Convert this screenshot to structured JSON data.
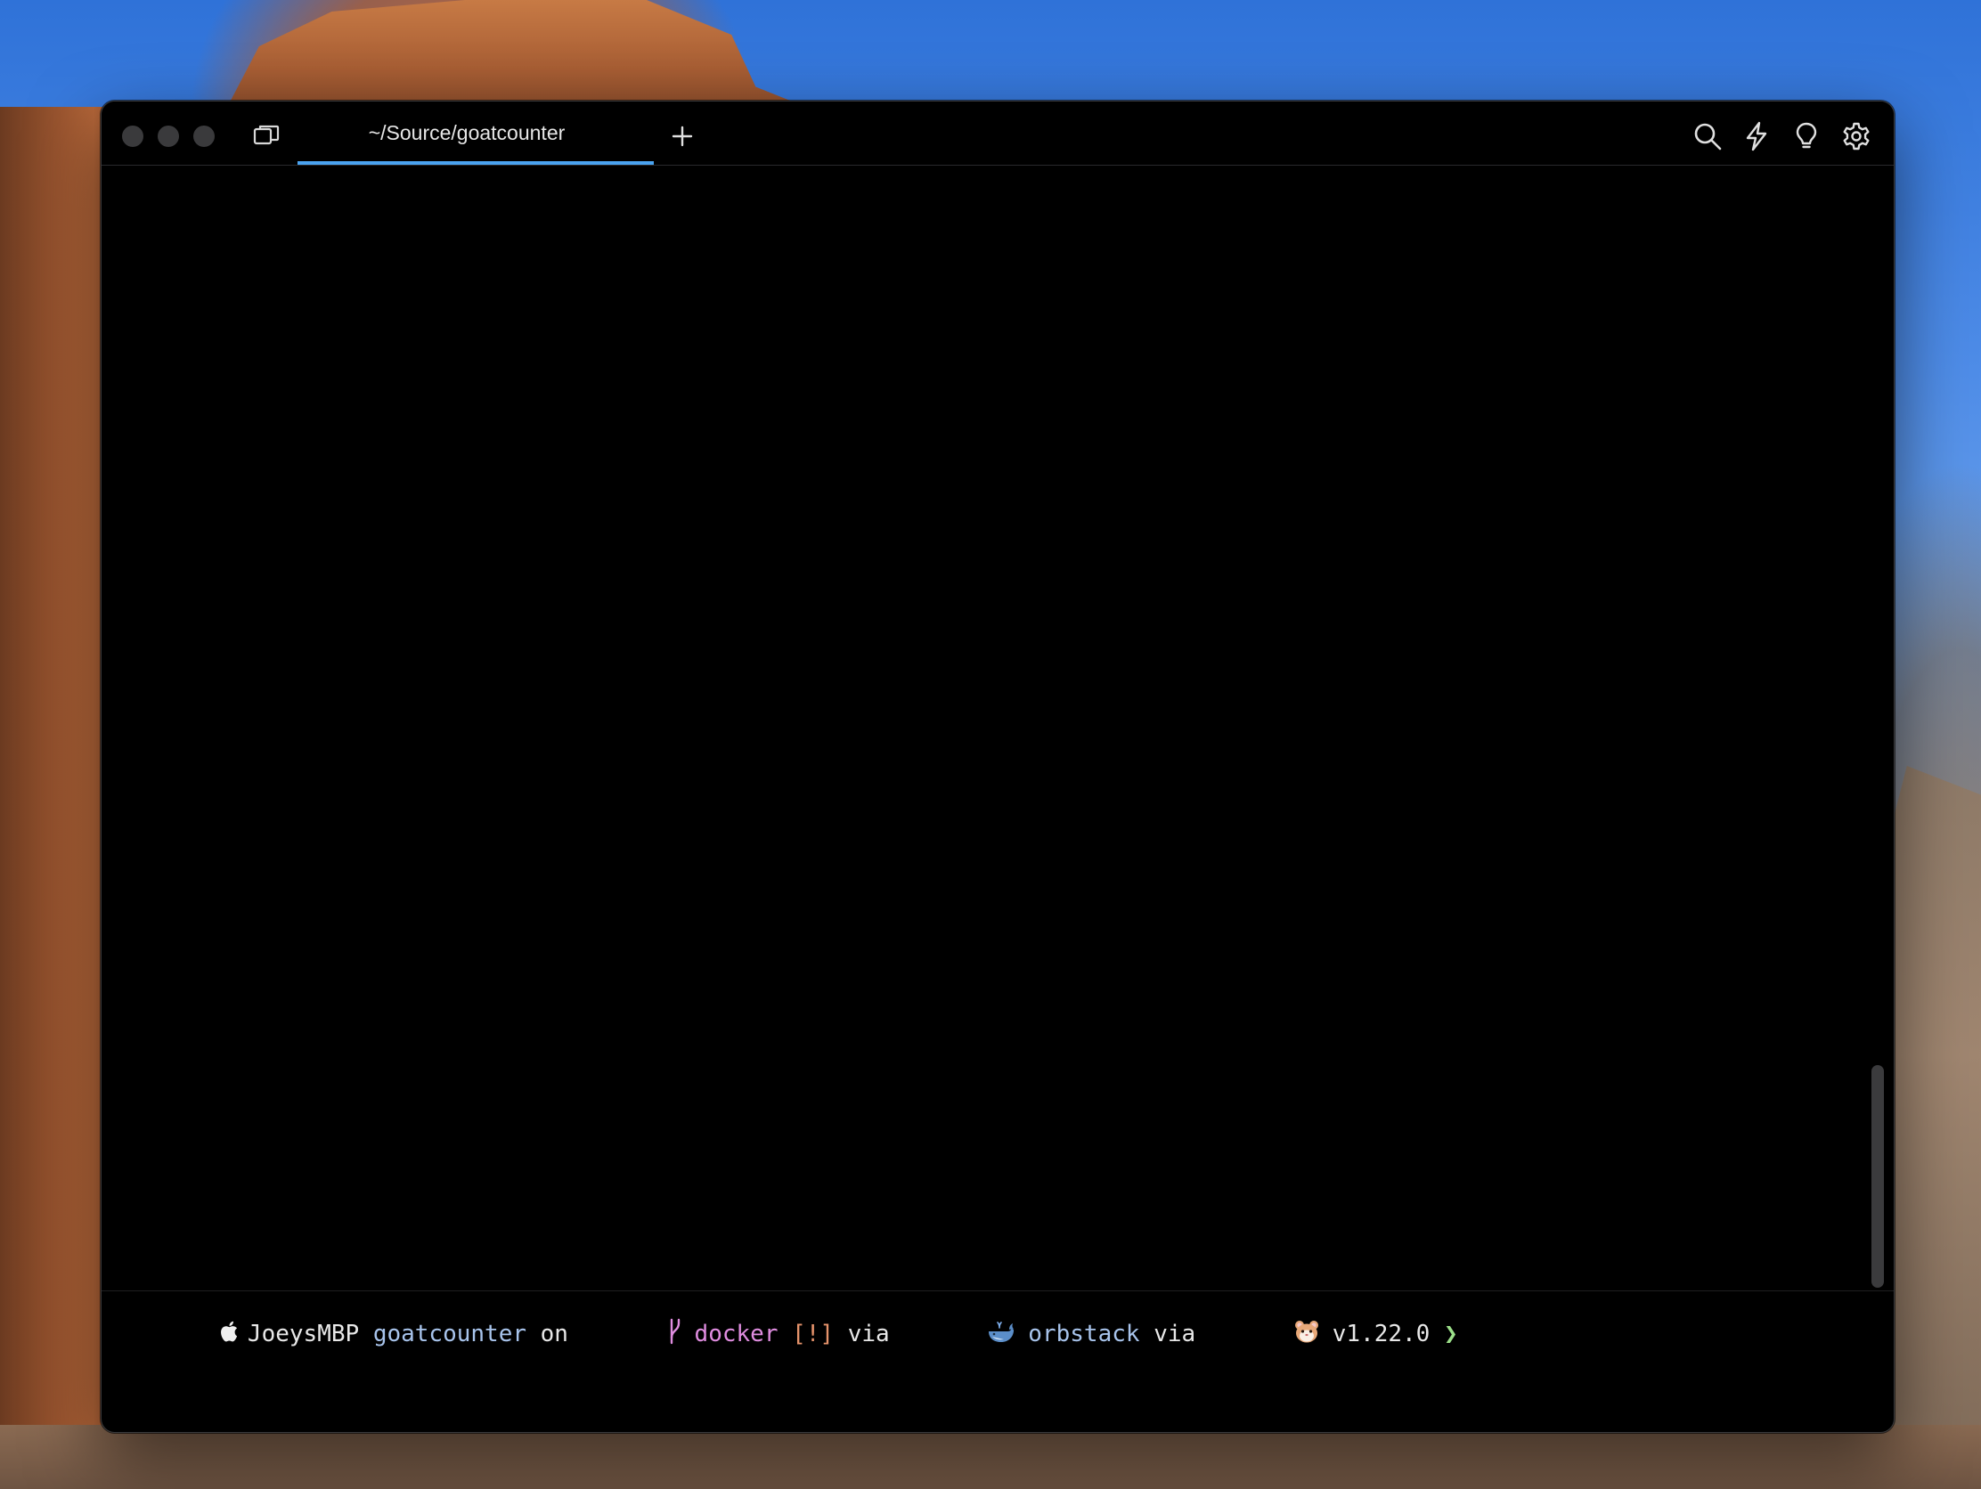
{
  "window": {
    "tab_title": "~/Source/goatcounter"
  },
  "toolbar": {
    "icons": [
      "sidebar-icon",
      "plus-icon",
      "search-icon",
      "bolt-icon",
      "lightbulb-icon",
      "gear-icon"
    ]
  },
  "prompt": {
    "host": "JoeysMBP",
    "directory": "goatcounter",
    "word_on": "on",
    "branch": "docker",
    "status": "[!]",
    "word_via_1": "via",
    "context": "orbstack",
    "word_via_2": "via",
    "version": "v1.22.0",
    "arrow": "❯"
  },
  "colors": {
    "accent": "#4aa3f0",
    "prompt_blue": "#a8c4ec",
    "prompt_purple": "#e08de0",
    "prompt_orange": "#e6936b",
    "prompt_green": "#9ce08a"
  }
}
